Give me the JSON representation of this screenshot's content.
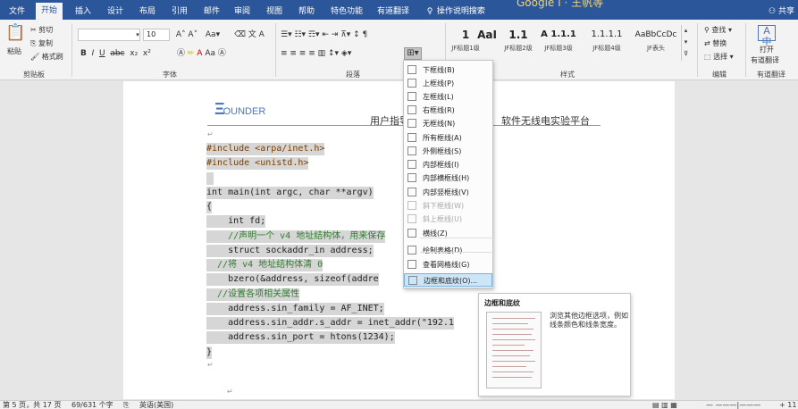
{
  "tabs": [
    "文件",
    "开始",
    "插入",
    "设计",
    "布局",
    "引用",
    "邮件",
    "审阅",
    "视图",
    "帮助",
    "特色功能",
    "有道翻译"
  ],
  "active_tab": "开始",
  "tell_me": "操作说明搜索",
  "doc_title": "Google I · 王帆等",
  "share": "共享",
  "ribbon": {
    "clipboard": {
      "paste": "粘贴",
      "cut": "剪切",
      "copy": "复制",
      "format_painter": "格式刷",
      "label": "剪贴板"
    },
    "font": {
      "name_value": "",
      "size_value": "10",
      "label": "字体"
    },
    "paragraph": {
      "label": "段落"
    },
    "styles": {
      "label": "样式",
      "items": [
        {
          "preview": "1",
          "name": "JF标题1级"
        },
        {
          "preview": "AaI",
          "name": "JF标题1级"
        },
        {
          "preview": "1.1",
          "name": "JF标题2级"
        },
        {
          "preview": "A 1.1.1",
          "name": "JF标题3级"
        },
        {
          "preview": "1.1.1.1",
          "name": "JF标题4级"
        },
        {
          "preview": "AaBbCcDc",
          "name": "JF表头"
        }
      ]
    },
    "editing": {
      "find": "查找",
      "replace": "替换",
      "select": "选择",
      "label": "编辑"
    },
    "youdao": {
      "open": "打开",
      "open2": "有道翻译",
      "label": "有道翻译"
    }
  },
  "document": {
    "logo_text": "OUNDER",
    "header_left": "用户指导",
    "header_right": "软件无线电实验平台",
    "code_lines": [
      "#include <arpa/inet.h>",
      "#include <unistd.h>",
      "",
      "int main(int argc, char **argv)",
      "{",
      "    int fd;",
      "    //声明一个 v4 地址结构体，用来保存",
      "    struct sockaddr_in address;",
      "  //将 v4 地址结构体清 0",
      "    bzero(&address, sizeof(addre",
      "  //设置各项相关属性",
      "    address.sin_family = AF_INET;",
      "    address.sin_addr.s_addr = inet_addr(\"192.1",
      "    address.sin_port = htons(1234);",
      "}"
    ]
  },
  "border_menu": {
    "items": [
      {
        "label": "下框线(B)",
        "disabled": false
      },
      {
        "label": "上框线(P)",
        "disabled": false
      },
      {
        "label": "左框线(L)",
        "disabled": false
      },
      {
        "label": "右框线(R)",
        "disabled": false
      },
      {
        "label": "无框线(N)",
        "disabled": false
      },
      {
        "label": "所有框线(A)",
        "disabled": false
      },
      {
        "label": "外侧框线(S)",
        "disabled": false
      },
      {
        "label": "内部框线(I)",
        "disabled": false
      },
      {
        "label": "内部横框线(H)",
        "disabled": false
      },
      {
        "label": "内部竖框线(V)",
        "disabled": false
      },
      {
        "label": "斜下框线(W)",
        "disabled": true
      },
      {
        "label": "斜上框线(U)",
        "disabled": true
      },
      {
        "label": "横线(Z)",
        "disabled": false
      },
      {
        "label": "绘制表格(D)",
        "disabled": false
      },
      {
        "label": "查看网格线(G)",
        "disabled": false
      },
      {
        "label": "边框和底纹(O)...",
        "disabled": false
      }
    ]
  },
  "tooltip": {
    "title": "边框和底纹",
    "description": "浏览其他边框选项，例如线条颜色和线条宽度。"
  },
  "status": {
    "page": "第 5 页，共 17 页",
    "words": "69/631 个字",
    "language": "英语(美国)",
    "zoom": "+ 11"
  },
  "colors": {
    "tab_bar": "#2b579a",
    "selection": "#d6d6d6",
    "menu_hover": "#cde6f7"
  }
}
